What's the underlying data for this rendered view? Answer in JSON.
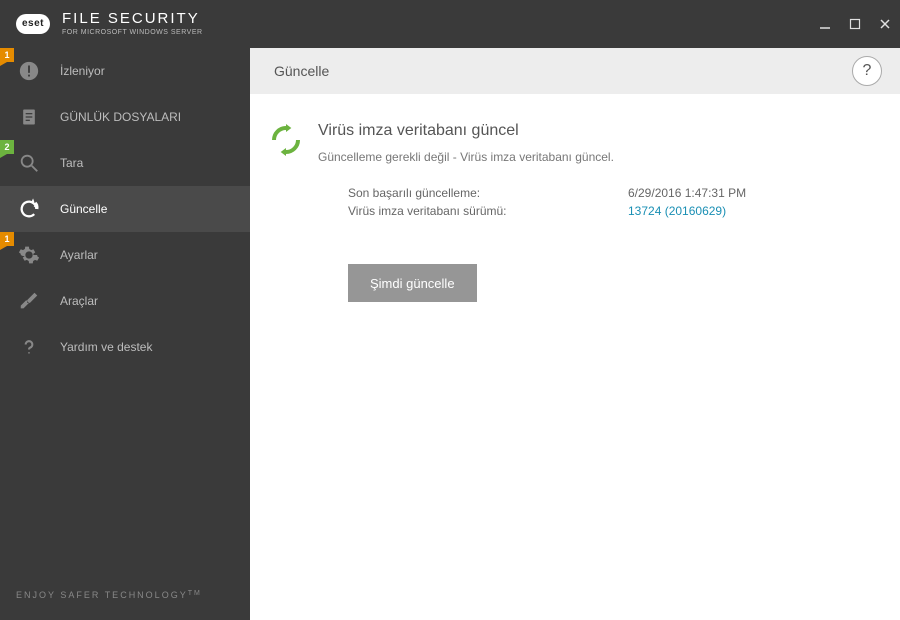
{
  "header": {
    "logo": "eset",
    "title": "FILE SECURITY",
    "subtitle": "FOR MICROSOFT WINDOWS SERVER"
  },
  "sidebar": {
    "items": [
      {
        "label": "İzleniyor",
        "badge": "1"
      },
      {
        "label": "GÜNLÜK DOSYALARI"
      },
      {
        "label": "Tara",
        "badge": "2"
      },
      {
        "label": "Güncelle"
      },
      {
        "label": "Ayarlar",
        "badge": "1"
      },
      {
        "label": "Araçlar"
      },
      {
        "label": "Yardım ve destek"
      }
    ],
    "footer": "ENJOY SAFER TECHNOLOGY"
  },
  "content": {
    "title": "Güncelle",
    "status_heading": "Virüs imza veritabanı güncel",
    "status_desc": "Güncelleme gerekli değil - Virüs imza veritabanı güncel.",
    "details": {
      "last_update_label": "Son başarılı güncelleme:",
      "last_update_value": "6/29/2016 1:47:31 PM",
      "db_version_label": "Virüs imza veritabanı sürümü:",
      "db_version_value": "13724 (20160629)"
    },
    "update_button": "Şimdi güncelle"
  }
}
